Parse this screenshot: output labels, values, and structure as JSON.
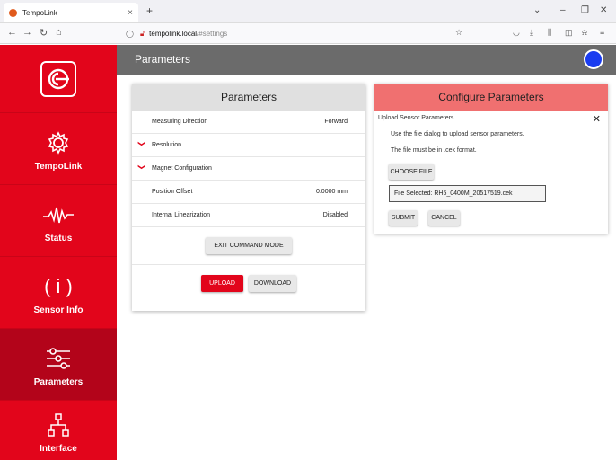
{
  "browser": {
    "tab_title": "TempoLink",
    "tab_close": "×",
    "new_tab": "+",
    "url_host": "tempolink.local",
    "url_path": "/#settings"
  },
  "sidebar": {
    "items": [
      {
        "label": "TempoLink",
        "icon": "gear-icon"
      },
      {
        "label": "Status",
        "icon": "signal-wave-icon"
      },
      {
        "label": "Sensor Info",
        "icon": "info-icon",
        "glyph": "( i )"
      },
      {
        "label": "Parameters",
        "icon": "sliders-icon"
      },
      {
        "label": "Interface",
        "icon": "network-icon"
      }
    ],
    "active_index": 3
  },
  "header": {
    "title": "Parameters",
    "status_color": "#1a3cf0"
  },
  "parameters_card": {
    "title": "Parameters",
    "rows": [
      {
        "label": "Measuring Direction",
        "value": "Forward"
      },
      {
        "label": "Resolution",
        "expandable": true
      },
      {
        "label": "Magnet Configuration",
        "expandable": true
      },
      {
        "label": "Position Offset",
        "value": "0.0000 mm"
      },
      {
        "label": "Internal Linearization",
        "value": "Disabled"
      }
    ],
    "exit_button": "EXIT COMMAND MODE",
    "upload_button": "UPLOAD",
    "download_button": "DOWNLOAD"
  },
  "configure_card": {
    "title": "Configure Parameters",
    "subtitle": "Upload Sensor Parameters",
    "close": "✕",
    "instruction": "Use the file dialog to upload sensor parameters.",
    "format_note": "The file must be in .cek format.",
    "choose_file": "CHOOSE FILE",
    "file_selected": "File Selected: RH5_0400M_20517519.cek",
    "submit": "SUBMIT",
    "cancel": "CANCEL"
  },
  "colors": {
    "brand_red": "#e2051b",
    "header_gray": "#6b6b6b",
    "configure_header": "#f07070"
  }
}
